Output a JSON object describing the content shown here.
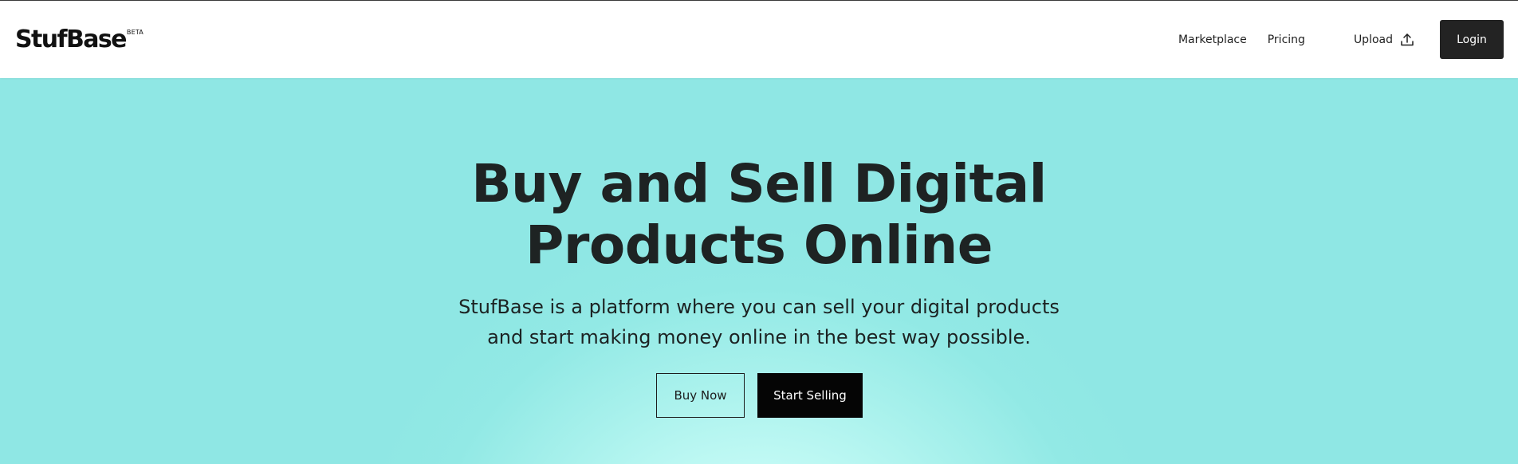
{
  "brand": {
    "name": "StufBase",
    "badge": "BETA"
  },
  "nav": {
    "marketplace": "Marketplace",
    "pricing": "Pricing",
    "upload": "Upload",
    "upload_icon": "upload-icon",
    "login": "Login"
  },
  "hero": {
    "title_line1": "Buy and Sell Digital",
    "title_line2": "Products Online",
    "subtitle_line1": "StufBase is a platform where you can sell your digital products",
    "subtitle_line2": "and start making money online in the best way possible.",
    "buy_now": "Buy Now",
    "start_selling": "Start Selling"
  },
  "colors": {
    "hero_background": "#8fe7e4",
    "hero_glow": "#d6fffb",
    "text_dark": "#1e2323",
    "button_dark": "#232323"
  }
}
